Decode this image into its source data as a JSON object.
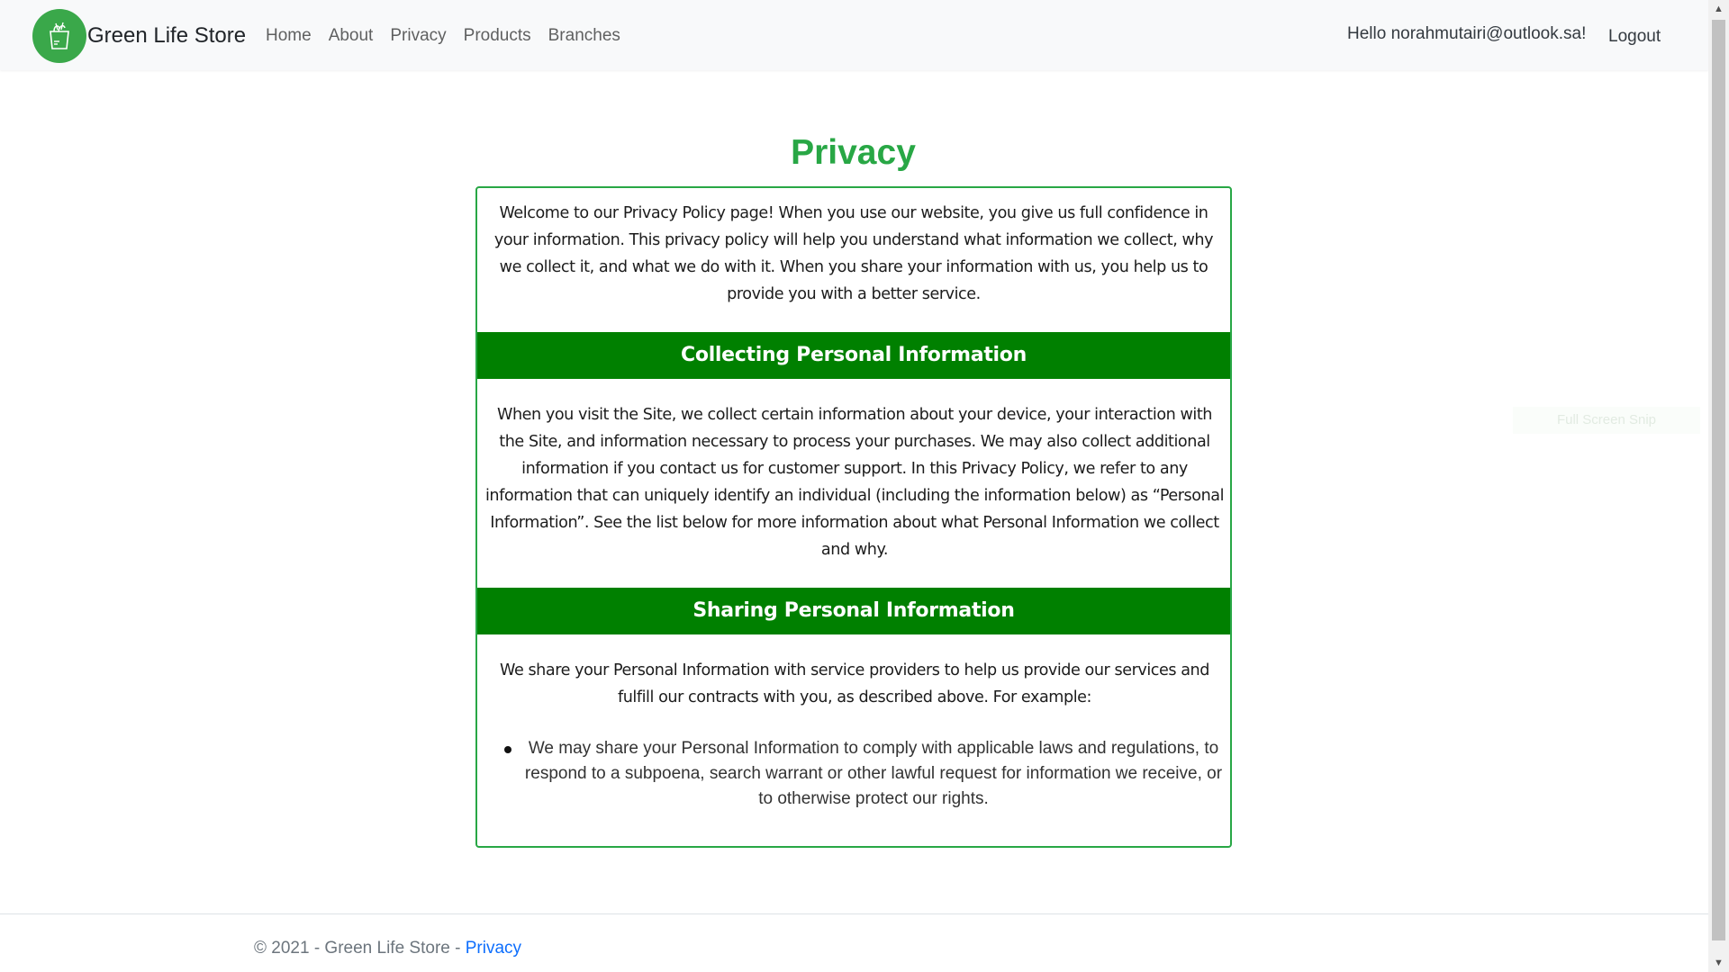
{
  "brand": {
    "name": "Green Life Store",
    "logo_icon": "grocery-bag-icon"
  },
  "nav": {
    "items": [
      {
        "label": "Home"
      },
      {
        "label": "About"
      },
      {
        "label": "Privacy"
      },
      {
        "label": "Products"
      },
      {
        "label": "Branches"
      }
    ],
    "greeting": "Hello norahmutairi@outlook.sa!",
    "logout": "Logout"
  },
  "page": {
    "title": "Privacy",
    "intro": "Welcome to our Privacy Policy page! When you use our website, you give us full confidence in your information. This privacy policy will help you understand what information we collect, why we collect it, and what we do with it. When you share your information with us, you help us to provide you with a better service.",
    "sections": [
      {
        "heading": "Collecting Personal Information",
        "text": "When you visit the Site, we collect certain information about your device, your interaction with the Site, and information necessary to process your purchases. We may also collect additional information if you contact us for customer support. In this Privacy Policy, we refer to any information that can uniquely identify an individual (including the information below) as “Personal Information”. See the list below for more information about what Personal Information we collect and why."
      },
      {
        "heading": "Sharing Personal Information",
        "text": "We share your Personal Information with service providers to help us provide our services and fulfill our contracts with you, as described above. For example:",
        "bullets": [
          "We may share your Personal Information to comply with applicable laws and regulations, to respond to a subpoena, search warrant or other lawful request for information we receive, or to otherwise protect our rights."
        ]
      }
    ]
  },
  "footer": {
    "copyright": "© 2021 - Green Life Store - ",
    "link": "Privacy"
  },
  "overlay": {
    "ghost_label": "Full Screen Snip"
  },
  "colors": {
    "accent_green": "#28a745",
    "section_green": "#008000",
    "logo_green": "#3aa84a",
    "link_blue": "#0d6efd"
  }
}
